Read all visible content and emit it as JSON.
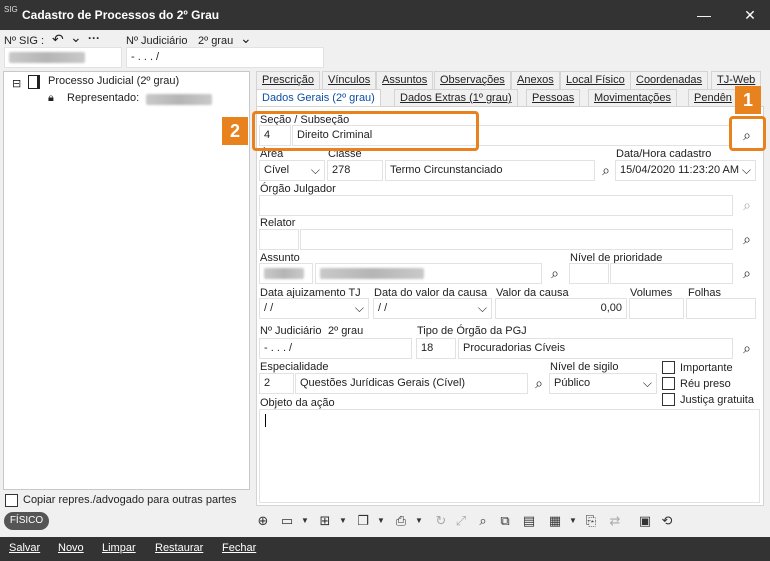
{
  "window": {
    "title": "Cadastro de Processos do 2º Grau",
    "icon_text": "SIG",
    "minimize": "—",
    "close": "✕"
  },
  "topbar": {
    "sig_label": "Nº SIG :",
    "undo_icon": "↶",
    "chevron": "⌄",
    "more": "···",
    "judiciario_label": "Nº Judiciário",
    "grau_label": "2º grau",
    "judiciario_value": "     -   .    .  .     /"
  },
  "tree": {
    "root_toggle": "⊟",
    "root_label": "Processo Judicial (2º grau)",
    "child_label": "Representado:"
  },
  "copy_reps": {
    "label": "Copiar repres./advogado para outras partes"
  },
  "fisico": "FÍSICO",
  "tabs_row1": [
    "Prescrição",
    "Vínculos",
    "Assuntos",
    "Observações",
    "Anexos",
    "Local Físico",
    "Coordenadas",
    "TJ-Web"
  ],
  "tabs_row2": [
    "Dados Gerais (2º grau)",
    "Dados Extras (1º grau)",
    "Pessoas",
    "Movimentações",
    "Pendên"
  ],
  "form": {
    "secao_label": "Seção / Subseção",
    "secao_code": "4",
    "secao_value": "Direito Criminal",
    "area_label": "Área",
    "area_value": "Cível",
    "classe_label": "Classe",
    "classe_code": "278",
    "classe_value": "Termo Circunstanciado",
    "data_cad_label": "Data/Hora cadastro",
    "data_cad_value": "15/04/2020 11:23:20 AM",
    "orgao_label": "Órgão Julgador",
    "relator_label": "Relator",
    "assunto_label": "Assunto",
    "prioridade_label": "Nível de prioridade",
    "data_ajuiz_label": "Data ajuizamento TJ",
    "data_ajuiz_value": " / /",
    "data_valor_label": "Data do valor da causa",
    "data_valor_value": " / /",
    "valor_label": "Valor da causa",
    "valor_value": "0,00",
    "volumes_label": "Volumes",
    "folhas_label": "Folhas",
    "njud_label": "Nº Judiciário",
    "njud_grau": "2º grau",
    "njud_value": "     -   .    .  .     /",
    "tipo_orgao_label": "Tipo de Órgão da PGJ",
    "tipo_orgao_code": "18",
    "tipo_orgao_value": "Procuradorias Cíveis",
    "especialidade_label": "Especialidade",
    "especialidade_code": "2",
    "especialidade_value": "Questões Jurídicas Gerais (Cível)",
    "sigilo_label": "Nível de sigilo",
    "sigilo_value": "Público",
    "importante_label": "Importante",
    "reu_preso_label": "Réu preso",
    "justica_label": "Justiça gratuita",
    "objeto_label": "Objeto da ação"
  },
  "annotations": {
    "badge1": "1",
    "badge2": "2"
  },
  "bottom": {
    "salvar": "Salvar",
    "novo": "Novo",
    "limpar": "Limpar",
    "restaurar": "Restaurar",
    "fechar": "Fechar"
  },
  "colors": {
    "accent_orange": "#e8821e",
    "titlebar": "#333333",
    "tab_active_text": "#0b4fa8"
  }
}
